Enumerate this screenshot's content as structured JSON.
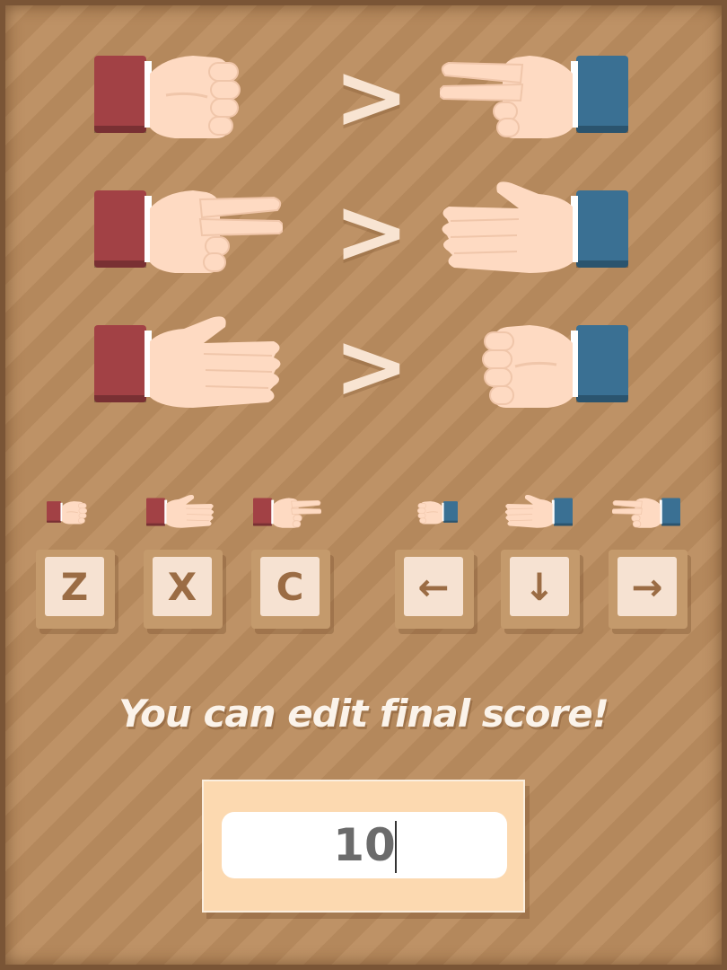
{
  "rules": [
    {
      "left": "rock",
      "right": "scissors",
      "symbol": ">"
    },
    {
      "left": "scissors",
      "right": "paper",
      "symbol": ">"
    },
    {
      "left": "paper",
      "right": "rock",
      "symbol": ">"
    }
  ],
  "player1": {
    "sleeve_color": "#a24145",
    "keys": [
      {
        "label": "Z",
        "gesture": "rock"
      },
      {
        "label": "X",
        "gesture": "paper"
      },
      {
        "label": "C",
        "gesture": "scissors"
      }
    ]
  },
  "player2": {
    "sleeve_color": "#3a7093",
    "keys": [
      {
        "label": "←",
        "icon": "arrow-left-icon",
        "gesture": "rock"
      },
      {
        "label": "↓",
        "icon": "arrow-down-icon",
        "gesture": "paper"
      },
      {
        "label": "→",
        "icon": "arrow-right-icon",
        "gesture": "scissors"
      }
    ]
  },
  "caption": "You can edit final score!",
  "score": {
    "value": "10"
  },
  "colors": {
    "background": "#bb8d5f",
    "skin": "#fedac2",
    "panel": "#fcd9b0",
    "key_face": "#f6e2d2"
  }
}
